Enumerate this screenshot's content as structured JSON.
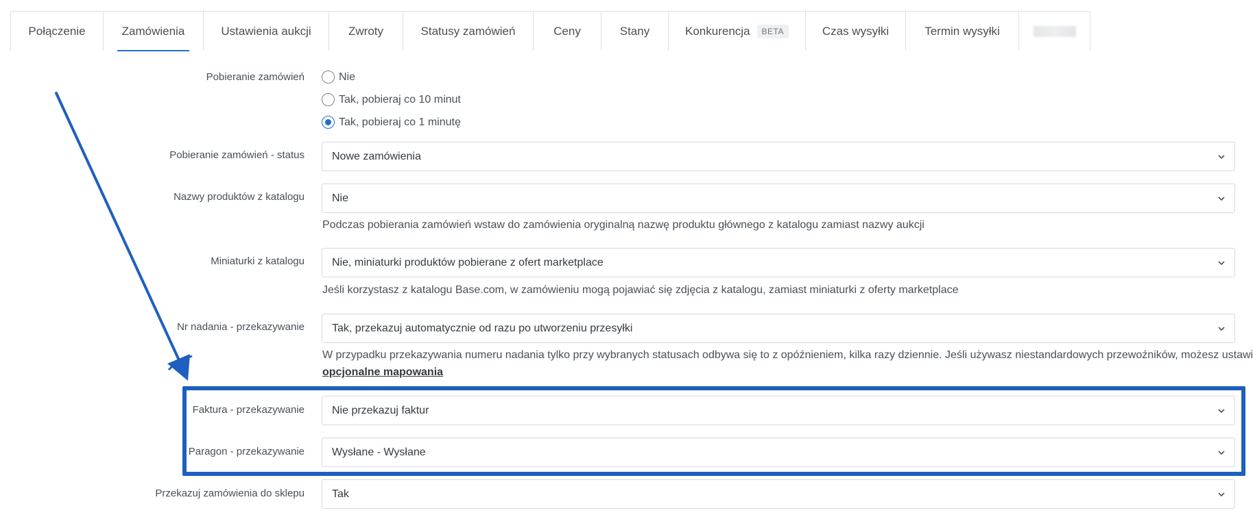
{
  "tabs": [
    {
      "label": "Połączenie",
      "active": false
    },
    {
      "label": "Zamówienia",
      "active": true
    },
    {
      "label": "Ustawienia aukcji",
      "active": false
    },
    {
      "label": "Zwroty",
      "active": false
    },
    {
      "label": "Statusy zamówień",
      "active": false
    },
    {
      "label": "Ceny",
      "active": false
    },
    {
      "label": "Stany",
      "active": false
    },
    {
      "label": "Konkurencja",
      "badge": "BETA",
      "active": false
    },
    {
      "label": "Czas wysyłki",
      "active": false
    },
    {
      "label": "Termin wysyłki",
      "active": false
    },
    {
      "label": "",
      "active": false
    }
  ],
  "form": {
    "order_download": {
      "label": "Pobieranie zamówień",
      "options": [
        "Nie",
        "Tak, pobieraj co 10 minut",
        "Tak, pobieraj co 1 minutę"
      ],
      "selected_index": 2
    },
    "order_download_status": {
      "label": "Pobieranie zamówień - status",
      "value": "Nowe zamówienia"
    },
    "product_names": {
      "label": "Nazwy produktów z katalogu",
      "value": "Nie",
      "help": "Podczas pobierania zamówień wstaw do zamówienia oryginalną nazwę produktu głównego z katalogu zamiast nazwy aukcji"
    },
    "thumbnails": {
      "label": "Miniaturki z katalogu",
      "value": "Nie, miniaturki produktów pobierane z ofert marketplace",
      "help": "Jeśli korzystasz z katalogu Base.com, w zamówieniu mogą pojawiać się zdjęcia z katalogu, zamiast miniaturki z oferty marketplace"
    },
    "tracking_number": {
      "label": "Nr nadania - przekazywanie",
      "value": "Tak, przekazuj automatycznie od razu po utworzeniu przesyłki",
      "help": "W przypadku przekazywania numeru nadania tylko przy wybranych statusach odbywa się to z opóźnieniem, kilka razy dziennie. Jeśli używasz niestandardowych przewoźników, możesz ustawić",
      "help_link": "opcjonalne mapowania"
    },
    "invoice": {
      "label": "Faktura - przekazywanie",
      "value": "Nie przekazuj faktur"
    },
    "receipt": {
      "label": "Paragon - przekazywanie",
      "value": "Wysłane - Wysłane"
    },
    "forward_orders": {
      "label": "Przekazuj zamówienia do sklepu",
      "value": "Tak"
    }
  },
  "icons": {
    "select": "chevron-down-icon",
    "annotation": "arrow-icon"
  },
  "colors": {
    "accent": "#1f6fd1",
    "annotation": "#1f5fbf"
  }
}
